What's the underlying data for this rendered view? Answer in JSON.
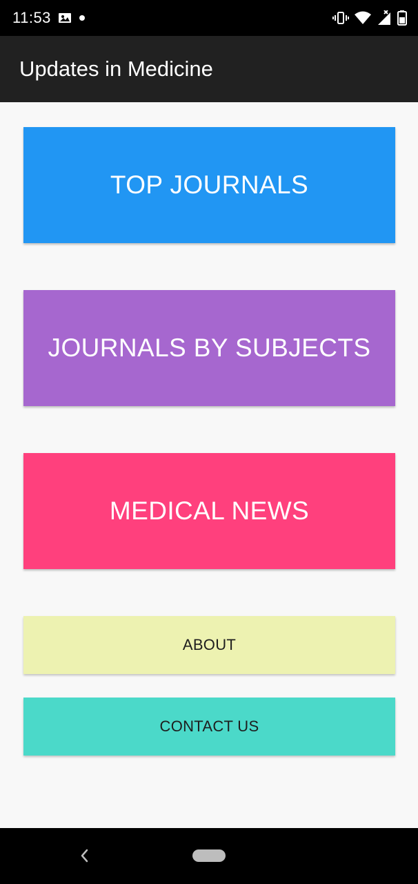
{
  "status_bar": {
    "time": "11:53",
    "icons": [
      "photo-icon",
      "notification-dot-icon",
      "vibrate-icon",
      "wifi-icon",
      "signal-icon",
      "battery-icon"
    ]
  },
  "app_bar": {
    "title": "Updates in Medicine"
  },
  "buttons": {
    "top_journals": {
      "label": "TOP JOURNALS",
      "color": "#2196F3"
    },
    "journals_by_subjects": {
      "label": "JOURNALS BY SUBJECTS",
      "color": "#A667CF"
    },
    "medical_news": {
      "label": "MEDICAL NEWS",
      "color": "#FF407D"
    },
    "about": {
      "label": "ABOUT",
      "color": "#EDF2B1"
    },
    "contact_us": {
      "label": "CONTACT US",
      "color": "#4BD9C9"
    }
  },
  "nav_bar": {
    "icons": [
      "back-icon",
      "home-pill-icon"
    ]
  }
}
